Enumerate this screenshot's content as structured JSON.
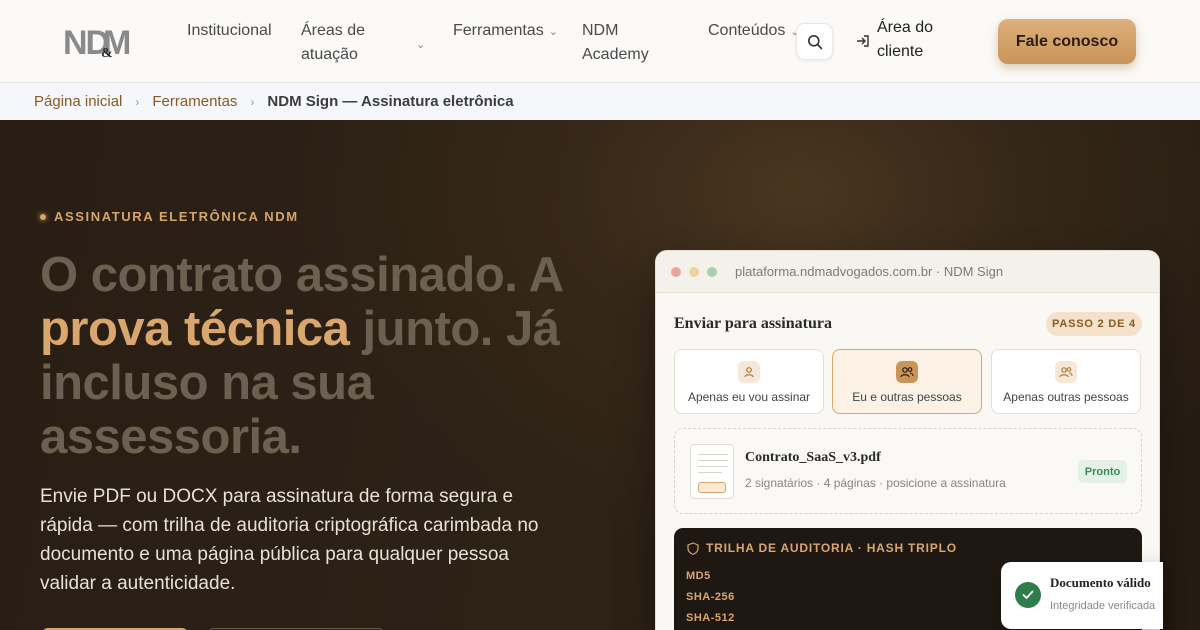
{
  "header": {
    "logo_text": "ND&M",
    "nav": [
      {
        "label": "Institucional"
      },
      {
        "label_line1": "Áreas de",
        "label_line2": "atuação"
      },
      {
        "label": "Ferramentas"
      },
      {
        "label_line1": "NDM",
        "label_line2": "Academy"
      },
      {
        "label": "Conteúdos"
      }
    ],
    "client_area_line1": "Área do",
    "client_area_line2": "cliente",
    "cta_label": "Fale conosco"
  },
  "breadcrumb": {
    "home": "Página inicial",
    "tools": "Ferramentas",
    "current": "NDM Sign — Assinatura eletrônica"
  },
  "hero": {
    "eyebrow": "ASSINATURA ELETRÔNICA NDM",
    "headline_part1": "O contrato assinado. A ",
    "headline_accent": "prova técnica",
    "headline_part2": " junto. Já incluso na sua assessoria.",
    "lead": "Envie PDF ou DOCX para assinatura de forma segura e rápida — com trilha de auditoria criptográfica carimbada no documento e uma página pública para qualquer pessoa validar a autenticidade."
  },
  "mock": {
    "url": "plataforma.ndmadvogados.com.br · NDM Sign",
    "title": "Enviar para assinatura",
    "step": "PASSO 2 DE 4",
    "options": [
      {
        "label": "Apenas eu vou assinar"
      },
      {
        "label": "Eu e outras pessoas"
      },
      {
        "label": "Apenas outras pessoas"
      }
    ],
    "document": {
      "name": "Contrato_SaaS_v3.pdf",
      "meta": "2 signatários · 4 páginas · posicione a assinatura",
      "status": "Pronto"
    },
    "audit": {
      "title": "TRILHA DE AUDITORIA · HASH TRIPLO",
      "hashes": [
        "MD5",
        "SHA-256",
        "SHA-512"
      ]
    }
  },
  "toast": {
    "title": "Documento válido",
    "subtitle": "Integridade verificada"
  },
  "colors": {
    "accent": "#d9a66d",
    "brand_dark": "#281e14",
    "success": "#2f7d4a"
  }
}
